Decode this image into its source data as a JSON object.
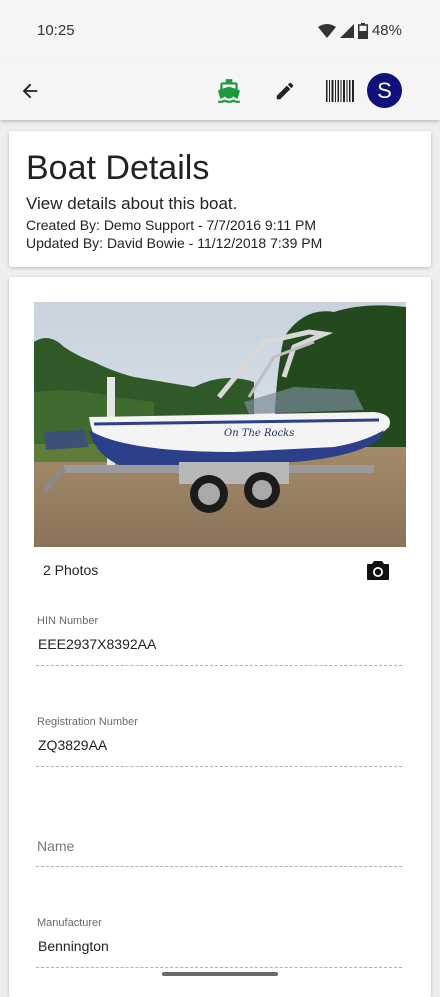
{
  "status_bar": {
    "time": "10:25",
    "battery": "48%"
  },
  "app_bar": {
    "avatar_letter": "S",
    "boat_icon_color": "#1a9a3a"
  },
  "header": {
    "title": "Boat Details",
    "subtitle": "View details about this boat.",
    "created": "Created By: Demo Support - 7/7/2016 9:11 PM",
    "updated": "Updated By: David Bowie - 11/12/2018 7:39 PM"
  },
  "photos": {
    "count_label": "2 Photos",
    "boat_script": "On The Rocks"
  },
  "fields": {
    "hin": {
      "label": "HIN Number",
      "value": "EEE2937X8392AA"
    },
    "registration": {
      "label": "Registration Number",
      "value": "ZQ3829AA"
    },
    "name": {
      "placeholder": "Name"
    },
    "manufacturer": {
      "label": "Manufacturer",
      "value": "Bennington"
    }
  },
  "colors": {
    "avatar_bg": "#0e117a",
    "boat_icon": "#1a9a3a"
  }
}
